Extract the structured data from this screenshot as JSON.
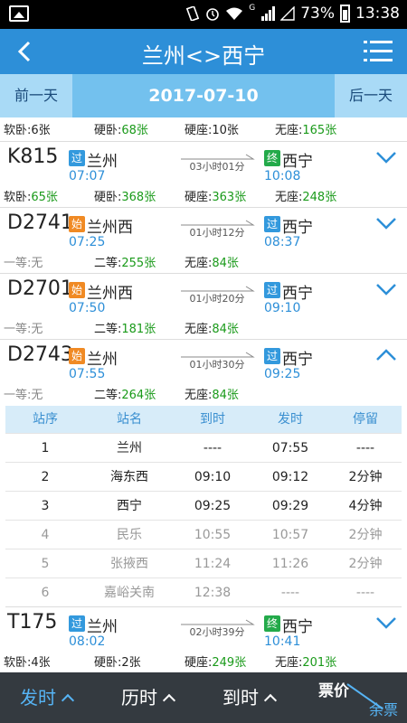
{
  "status_bar": {
    "battery": "73%",
    "time": "13:38",
    "signal_label": "G"
  },
  "header": {
    "title": "兰州<>西宁",
    "back_icon": "chevron-left-icon",
    "menu_icon": "menu-icon"
  },
  "date_bar": {
    "prev_label": "前一天",
    "date": "2017-07-10",
    "next_label": "后一天"
  },
  "partial_row": {
    "seats": [
      {
        "name": "软卧:",
        "count": "6张",
        "highlight": false
      },
      {
        "name": "硬卧:",
        "count": "68张",
        "highlight": true
      },
      {
        "name": "硬座:",
        "count": "10张",
        "highlight": false
      },
      {
        "name": "无座:",
        "count": "165张",
        "highlight": true
      }
    ]
  },
  "trains": [
    {
      "code": "K815",
      "from_badge": "过",
      "from_type": "pass",
      "from_station": "兰州",
      "dep_time": "07:07",
      "duration": "03小时01分",
      "to_badge": "终",
      "to_type": "end",
      "to_station": "西宁",
      "arr_time": "10:08",
      "expanded": false,
      "seats": [
        {
          "name": "软卧:",
          "count": "65张"
        },
        {
          "name": "硬卧:",
          "count": "368张"
        },
        {
          "name": "硬座:",
          "count": "363张"
        },
        {
          "name": "无座:",
          "count": "248张"
        }
      ]
    },
    {
      "code": "D2741",
      "from_badge": "始",
      "from_type": "start",
      "from_station": "兰州西",
      "dep_time": "07:25",
      "duration": "01小时12分",
      "to_badge": "过",
      "to_type": "pass",
      "to_station": "西宁",
      "arr_time": "08:37",
      "expanded": false,
      "seats": [
        {
          "name": "一等:",
          "count": "无"
        },
        {
          "name": "二等:",
          "count": "255张"
        },
        {
          "name": "无座:",
          "count": "84张"
        }
      ]
    },
    {
      "code": "D2701",
      "from_badge": "始",
      "from_type": "start",
      "from_station": "兰州西",
      "dep_time": "07:50",
      "duration": "01小时20分",
      "to_badge": "过",
      "to_type": "pass",
      "to_station": "西宁",
      "arr_time": "09:10",
      "expanded": false,
      "seats": [
        {
          "name": "一等:",
          "count": "无"
        },
        {
          "name": "二等:",
          "count": "181张"
        },
        {
          "name": "无座:",
          "count": "84张"
        }
      ]
    },
    {
      "code": "D2743",
      "from_badge": "始",
      "from_type": "start",
      "from_station": "兰州",
      "dep_time": "07:55",
      "duration": "01小时30分",
      "to_badge": "过",
      "to_type": "pass",
      "to_station": "西宁",
      "arr_time": "09:25",
      "expanded": true,
      "seats": [
        {
          "name": "一等:",
          "count": "无"
        },
        {
          "name": "二等:",
          "count": "264张"
        },
        {
          "name": "无座:",
          "count": "84张"
        }
      ]
    },
    {
      "code": "T175",
      "from_badge": "过",
      "from_type": "pass",
      "from_station": "兰州",
      "dep_time": "08:02",
      "duration": "02小时39分",
      "to_badge": "终",
      "to_type": "end",
      "to_station": "西宁",
      "arr_time": "10:41",
      "expanded": false,
      "seats": [
        {
          "name": "软卧:",
          "count": "4张"
        },
        {
          "name": "硬卧:",
          "count": "2张"
        },
        {
          "name": "硬座:",
          "count": "249张"
        },
        {
          "name": "无座:",
          "count": "201张"
        }
      ]
    }
  ],
  "stop_table": {
    "headers": [
      "站序",
      "站名",
      "到时",
      "发时",
      "停留"
    ],
    "rows": [
      {
        "seq": "1",
        "station": "兰州",
        "arrive": "----",
        "depart": "07:55",
        "stay": "----",
        "active": true
      },
      {
        "seq": "2",
        "station": "海东西",
        "arrive": "09:10",
        "depart": "09:12",
        "stay": "2分钟",
        "active": true
      },
      {
        "seq": "3",
        "station": "西宁",
        "arrive": "09:25",
        "depart": "09:29",
        "stay": "4分钟",
        "active": true
      },
      {
        "seq": "4",
        "station": "民乐",
        "arrive": "10:55",
        "depart": "10:57",
        "stay": "2分钟",
        "active": false
      },
      {
        "seq": "5",
        "station": "张掖西",
        "arrive": "11:24",
        "depart": "11:26",
        "stay": "2分钟",
        "active": false
      },
      {
        "seq": "6",
        "station": "嘉峪关南",
        "arrive": "12:38",
        "depart": "----",
        "stay": "----",
        "active": false
      }
    ]
  },
  "bottom_tabs": {
    "depart": "发时",
    "duration": "历时",
    "arrive": "到时",
    "price_top": "票价",
    "price_bottom": "余票"
  },
  "colors": {
    "accent": "#2d8fd8",
    "count_green": "#1a9a1a",
    "badge_start": "#f08a24",
    "badge_end": "#23aa4a",
    "badge_pass": "#3399dd"
  }
}
